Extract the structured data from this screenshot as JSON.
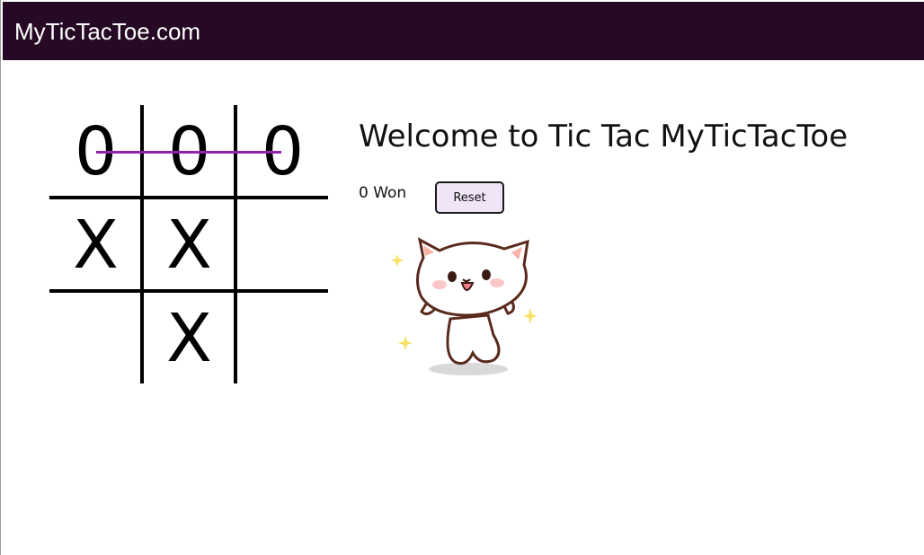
{
  "navbar": {
    "brand": "MyTicTacToe.com",
    "background": "#260924"
  },
  "game": {
    "board": [
      [
        "0",
        "0",
        "0"
      ],
      [
        "X",
        "X",
        ""
      ],
      [
        "",
        "X",
        ""
      ]
    ],
    "winning_line_color": "#8e24aa"
  },
  "panel": {
    "title": "Welcome to Tic Tac MyTicTacToe",
    "score": "0 Won",
    "reset_label": "Reset",
    "reset_bg": "#f0e4f7"
  },
  "illustration": {
    "icon": "happy-cat-sticker"
  }
}
